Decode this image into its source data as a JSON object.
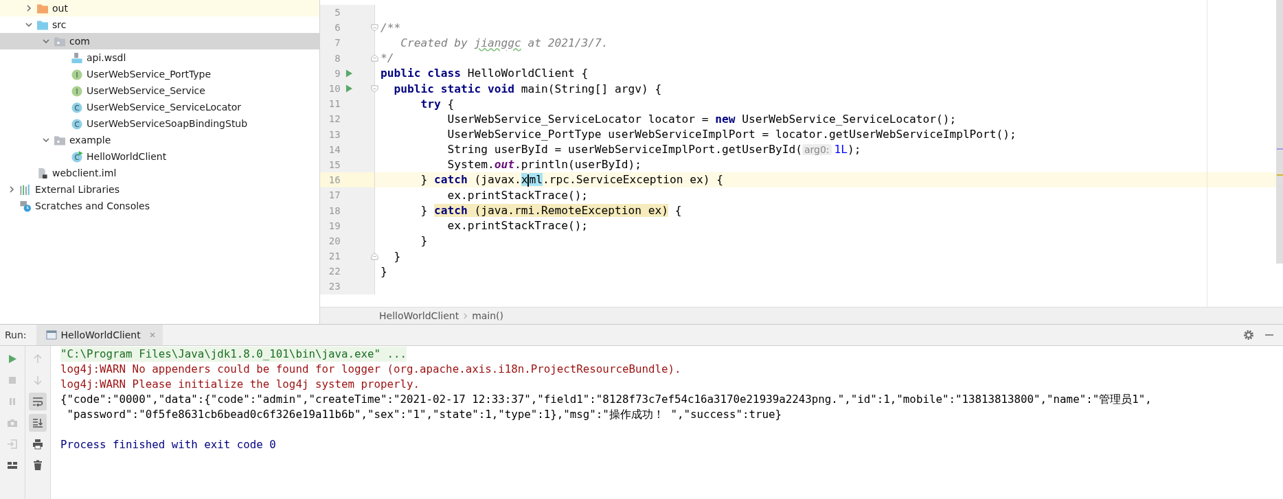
{
  "project_tree": {
    "module_items": [
      {
        "label": "out",
        "kind": "folder",
        "excluded": true,
        "expanded": false,
        "selected": false
      },
      {
        "label": "src",
        "kind": "sourcefolder",
        "expanded": true,
        "selected": false,
        "children": [
          {
            "label": "com",
            "kind": "package",
            "expanded": true,
            "selected": true,
            "children": [
              {
                "label": "api.wsdl",
                "kind": "wsdl",
                "selected": false
              },
              {
                "label": "UserWebService_PortType",
                "kind": "interface",
                "icon_letter": "I",
                "selected": false
              },
              {
                "label": "UserWebService_Service",
                "kind": "interface",
                "icon_letter": "I",
                "selected": false
              },
              {
                "label": "UserWebService_ServiceLocator",
                "kind": "class",
                "icon_letter": "C",
                "selected": false
              },
              {
                "label": "UserWebServiceSoapBindingStub",
                "kind": "class",
                "icon_letter": "C",
                "selected": false
              }
            ]
          },
          {
            "label": "example",
            "kind": "package",
            "expanded": true,
            "selected": false,
            "children": [
              {
                "label": "HelloWorldClient",
                "kind": "runnable",
                "icon_letter": "C",
                "selected": false
              }
            ]
          }
        ]
      },
      {
        "label": "webclient.iml",
        "kind": "module",
        "selected": false
      }
    ],
    "root_items": [
      {
        "label": "External Libraries",
        "kind": "libraries",
        "expanded": false,
        "selected": false
      },
      {
        "label": "Scratches and Consoles",
        "kind": "scratches",
        "selected": false
      }
    ]
  },
  "editor": {
    "lines": [
      {
        "number": "5",
        "kind": "plain",
        "current": false,
        "run": false
      },
      {
        "number": "6",
        "kind": "foldstart",
        "current": false,
        "run": false,
        "segments": [
          {
            "kind": "comment",
            "text": "/**"
          }
        ]
      },
      {
        "number": "7",
        "kind": "plain",
        "current": false,
        "run": false,
        "segments": [
          {
            "kind": "comment",
            "text": "   Created by "
          },
          {
            "kind": "typo",
            "text": "jianggc"
          },
          {
            "kind": "comment",
            "text": " at 2021/3/7."
          }
        ]
      },
      {
        "number": "8",
        "kind": "foldend",
        "current": false,
        "run": false,
        "segments": [
          {
            "kind": "comment",
            "text": "*/"
          }
        ]
      },
      {
        "number": "9",
        "kind": "plain",
        "current": false,
        "run": true,
        "segments": [
          {
            "kind": "keyword",
            "text": "public class"
          },
          {
            "kind": "plain",
            "text": " HelloWorldClient {"
          }
        ]
      },
      {
        "number": "10",
        "kind": "foldstart",
        "current": false,
        "run": true,
        "segments": [
          {
            "kind": "keyword",
            "text": "  public static void"
          },
          {
            "kind": "plain",
            "text": " main(String[] argv) {"
          }
        ]
      },
      {
        "number": "11",
        "kind": "plain",
        "current": false,
        "run": false,
        "segments": [
          {
            "kind": "keyword",
            "text": "      try"
          },
          {
            "kind": "plain",
            "text": " {"
          }
        ]
      },
      {
        "number": "12",
        "kind": "plain",
        "current": false,
        "run": false,
        "segments": [
          {
            "kind": "plain",
            "text": "          UserWebService_ServiceLocator locator = "
          },
          {
            "kind": "keyword",
            "text": "new"
          },
          {
            "kind": "plain",
            "text": " UserWebService_ServiceLocator();"
          }
        ]
      },
      {
        "number": "13",
        "kind": "plain",
        "current": false,
        "run": false,
        "segments": [
          {
            "kind": "plain",
            "text": "          UserWebService_PortType userWebServiceImplPort = locator.getUserWebServiceImplPort();"
          }
        ]
      },
      {
        "number": "14",
        "kind": "plain",
        "current": false,
        "run": false,
        "segments": [
          {
            "kind": "plain",
            "text": "          String userById = userWebServiceImplPort.getUserById("
          },
          {
            "kind": "hint",
            "text": "arg0:"
          },
          {
            "kind": "number",
            "text": "1L"
          },
          {
            "kind": "plain",
            "text": ");"
          }
        ]
      },
      {
        "number": "15",
        "kind": "plain",
        "current": false,
        "run": false,
        "segments": [
          {
            "kind": "plain",
            "text": "          System."
          },
          {
            "kind": "static",
            "text": "out"
          },
          {
            "kind": "plain",
            "text": ".println(userById);"
          }
        ]
      },
      {
        "number": "16",
        "kind": "plain",
        "current": true,
        "run": false,
        "segments": [
          {
            "kind": "plain",
            "text": "      } "
          },
          {
            "kind": "keyword",
            "text": "catch"
          },
          {
            "kind": "plain",
            "text": " (javax."
          },
          {
            "kind": "match",
            "text": "x"
          },
          {
            "kind": "caret"
          },
          {
            "kind": "match",
            "text": "ml"
          },
          {
            "kind": "plain",
            "text": ".rpc.ServiceException ex) {"
          }
        ]
      },
      {
        "number": "17",
        "kind": "plain",
        "current": false,
        "run": false,
        "segments": [
          {
            "kind": "plain",
            "text": "          ex.printStackTrace();"
          }
        ]
      },
      {
        "number": "18",
        "kind": "plain",
        "current": false,
        "run": false,
        "segments": [
          {
            "kind": "plain",
            "text": "      } "
          },
          {
            "kind": "warnkeyword",
            "text": "catch"
          },
          {
            "kind": "warntext",
            "text": " (java.rmi.RemoteException ex)"
          },
          {
            "kind": "plain",
            "text": " {"
          }
        ]
      },
      {
        "number": "19",
        "kind": "plain",
        "current": false,
        "run": false,
        "segments": [
          {
            "kind": "plain",
            "text": "          ex.printStackTrace();"
          }
        ]
      },
      {
        "number": "20",
        "kind": "plain",
        "current": false,
        "run": false,
        "segments": [
          {
            "kind": "plain",
            "text": "      }"
          }
        ]
      },
      {
        "number": "21",
        "kind": "foldend",
        "current": false,
        "run": false,
        "segments": [
          {
            "kind": "plain",
            "text": "  }"
          }
        ]
      },
      {
        "number": "22",
        "kind": "plain",
        "current": false,
        "run": false,
        "segments": [
          {
            "kind": "plain",
            "text": "}"
          }
        ]
      },
      {
        "number": "23",
        "kind": "plain",
        "current": false,
        "run": false
      }
    ],
    "breadcrumbs": [
      "HelloWorldClient",
      "main()"
    ]
  },
  "run_panel": {
    "label": "Run:",
    "tab": {
      "label": "HelloWorldClient",
      "selected": true
    },
    "left_tools": [
      {
        "kind": "run",
        "disabled": false
      },
      {
        "kind": "stop",
        "disabled": true
      },
      {
        "kind": "pause",
        "disabled": true
      },
      {
        "kind": "camera",
        "disabled": true
      },
      {
        "kind": "import",
        "disabled": true
      },
      {
        "kind": "layout",
        "disabled": false
      }
    ],
    "right_tools": [
      {
        "kind": "up",
        "disabled": true,
        "on": false
      },
      {
        "kind": "down",
        "disabled": true,
        "on": false
      },
      {
        "kind": "wrap",
        "disabled": false,
        "on": true
      },
      {
        "kind": "scrollend",
        "disabled": false,
        "on": true
      },
      {
        "kind": "print",
        "disabled": false,
        "on": false
      },
      {
        "kind": "trash",
        "disabled": false,
        "on": false
      }
    ],
    "console": [
      {
        "kind": "command",
        "text": "\"C:\\Program Files\\Java\\jdk1.8.0_101\\bin\\java.exe\" ..."
      },
      {
        "kind": "warn",
        "text": "log4j:WARN No appenders could be found for logger (org.apache.axis.i18n.ProjectResourceBundle)."
      },
      {
        "kind": "warn",
        "text": "log4j:WARN Please initialize the log4j system properly."
      },
      {
        "kind": "output",
        "text": "{\"code\":\"0000\",\"data\":{\"code\":\"admin\",\"createTime\":\"2021-02-17 12:33:37\",\"field1\":\"8128f73c7ef54c16a3170e21939a2243png.\",\"id\":1,\"mobile\":\"13813813800\",\"name\":\"管理员1\","
      },
      {
        "kind": "output",
        "text": " \"password\":\"0f5fe8631cb6bead0c6f326e19a11b6b\",\"sex\":\"1\",\"state\":1,\"type\":1},\"msg\":\"操作成功！ \",\"success\":true}"
      },
      {
        "kind": "blank"
      },
      {
        "kind": "info",
        "text": "Process finished with exit code 0"
      }
    ]
  }
}
